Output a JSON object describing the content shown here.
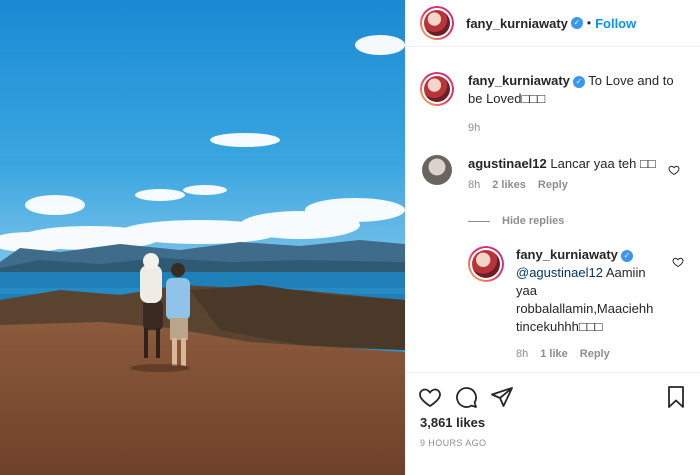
{
  "post": {
    "author": "fany_kurniawaty",
    "follow_label": "Follow",
    "dot": "•"
  },
  "caption": {
    "author": "fany_kurniawaty",
    "text": "To Love and to be Loved□□□",
    "time": "9h"
  },
  "comments": [
    {
      "author": "agustinael12",
      "text": "Lancar yaa teh □□",
      "time": "8h",
      "likes": "2 likes",
      "reply_label": "Reply"
    }
  ],
  "hide_replies_label": "Hide replies",
  "reply": {
    "author": "fany_kurniawaty",
    "mention": "@agustinael12",
    "text": " Aamiin yaa robbalallamin,Maaciehh tincekuhhh□□□",
    "time": "8h",
    "likes": "1 like",
    "reply_label": "Reply"
  },
  "footer": {
    "likes": "3,861 likes",
    "timestamp": "9 HOURS AGO"
  },
  "icons": {
    "like": "heart-icon",
    "comment": "comment-icon",
    "share": "paper-plane-icon",
    "save": "bookmark-icon"
  },
  "colors": {
    "accent": "#0095f6",
    "verified": "#3897f0",
    "muted": "#8e8e8e"
  }
}
